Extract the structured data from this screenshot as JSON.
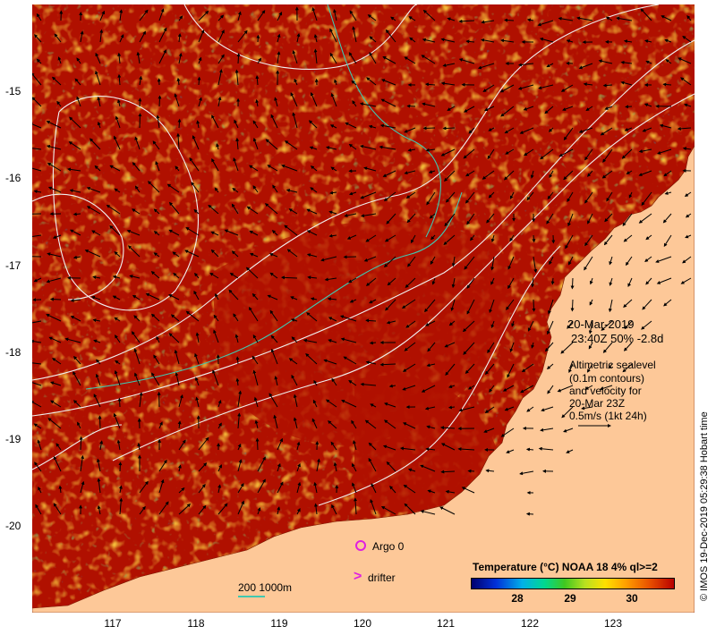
{
  "map": {
    "y_axis_labels": [
      "-15",
      "-16",
      "-17",
      "-18",
      "-19",
      "-20"
    ],
    "x_axis_labels": [
      "117",
      "118",
      "119",
      "120",
      "121",
      "122",
      "123"
    ],
    "colors": {
      "land": "#fdc898",
      "sea_base": "#b01000",
      "contour": "#f0f0f0",
      "contour_alt": "#40c8b0",
      "arrow": "#000000"
    }
  },
  "annotation": {
    "date": "20-Mar-2019",
    "time_line": "23:40Z  50% -2.8d",
    "alt_line1": "Altimetric sealevel",
    "alt_line2": "(0.1m contours)",
    "alt_line3": "and velocity for",
    "alt_line4": "20-Mar 23Z",
    "alt_line5": "0.5m/s (1kt 24h)"
  },
  "legend": {
    "argo": "Argo 0",
    "drifter": "drifter",
    "scale": "200  1000m",
    "colorbar_title": "Temperature (°C) NOAA 18 4% ql>=2",
    "colorbar_ticks": [
      "28",
      "29",
      "30"
    ]
  },
  "credit": "© IMOS 19-Dec-2019 05:29:38 Hobart time"
}
